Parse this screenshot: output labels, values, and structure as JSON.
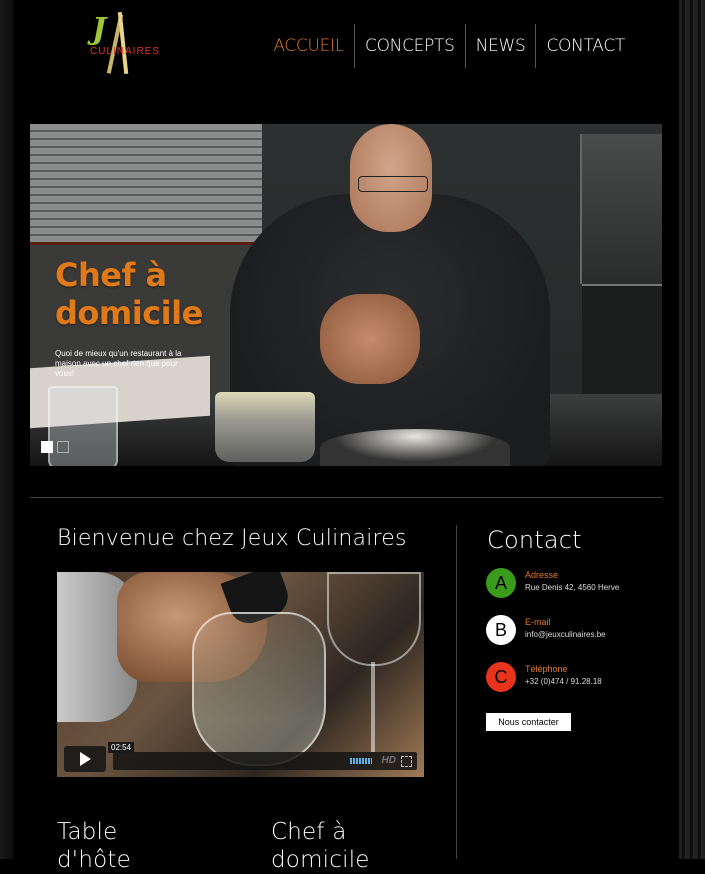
{
  "brand": {
    "logo_text": "CULINAIRES",
    "logo_initial": "J"
  },
  "nav": {
    "items": [
      {
        "label": "ACCUEIL",
        "active": true
      },
      {
        "label": "CONCEPTS"
      },
      {
        "label": "NEWS"
      },
      {
        "label": "CONTACT"
      }
    ],
    "active_color": "#e07a2c"
  },
  "hero": {
    "title_line1": "Chef à",
    "title_line2": "domicile",
    "subtitle": "Quoi de mieux qu'un restaurant à la maison avec un chef rien que pour vous!",
    "slide_count": 2,
    "active_slide": 1,
    "accent": "#e07a19"
  },
  "main": {
    "heading": "Bienvenue chez Jeux Culinaires",
    "video": {
      "time": "02:54",
      "hd_label": "HD"
    },
    "cards": [
      {
        "title_line1": "Table",
        "title_line2": "d'hôte"
      },
      {
        "title_line1": "Chef à",
        "title_line2": "domicile"
      }
    ]
  },
  "contact": {
    "heading": "Contact",
    "items": [
      {
        "badge": "A",
        "badge_color": "#3a9a1c",
        "label": "Adresse",
        "value": "Rue Denis 42, 4560 Herve"
      },
      {
        "badge": "B",
        "badge_color": "#ffffff",
        "label": "E-mail",
        "value": "info@jeuxculinaires.be"
      },
      {
        "badge": "C",
        "badge_color": "#e8341c",
        "label": "Téléphone",
        "value": "+32 (0)474 / 91.28.18"
      }
    ],
    "button_label": "Nous contacter"
  }
}
